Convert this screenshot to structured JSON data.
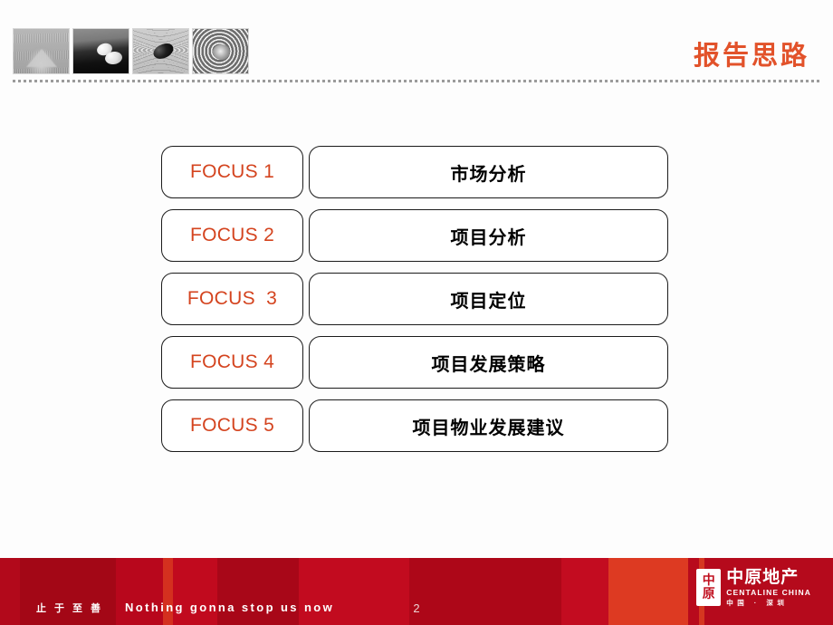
{
  "slide": {
    "page_number": "2",
    "background_color": "#fdfdfd"
  },
  "header": {
    "title": "报告思路",
    "title_color": "#e2522a",
    "thumbnails": [
      {
        "name": "sand-cone-photo",
        "alt": "zen sand cone"
      },
      {
        "name": "white-pebbles-photo",
        "alt": "white pebbles on dark water"
      },
      {
        "name": "black-pebble-ripples-photo",
        "alt": "black pebble in sand ripples"
      },
      {
        "name": "water-rings-photo",
        "alt": "concentric water ripples"
      }
    ],
    "divider": "dashed-rule"
  },
  "agenda": {
    "rows": [
      {
        "focus": "FOCUS 1",
        "topic": "市场分析"
      },
      {
        "focus": "FOCUS 2",
        "topic": "项目分析"
      },
      {
        "focus": "FOCUS  3",
        "topic": "项目定位"
      },
      {
        "focus": "FOCUS 4",
        "topic": "项目发展策略"
      },
      {
        "focus": "FOCUS 5",
        "topic": "项目物业发展建议"
      }
    ],
    "focus_color": "#d4441f",
    "topic_color": "#000000"
  },
  "footer": {
    "background_color": "#b40a1c",
    "tagline_cn": "止于至善",
    "tagline_en": "Nothing gonna stop us now",
    "page_number": "2",
    "logo": {
      "mark_char_top": "中",
      "mark_char_bottom": "原",
      "name_cn": "中原地产",
      "name_en": "CENTALINE CHINA",
      "region": "中国 · 深圳"
    }
  }
}
